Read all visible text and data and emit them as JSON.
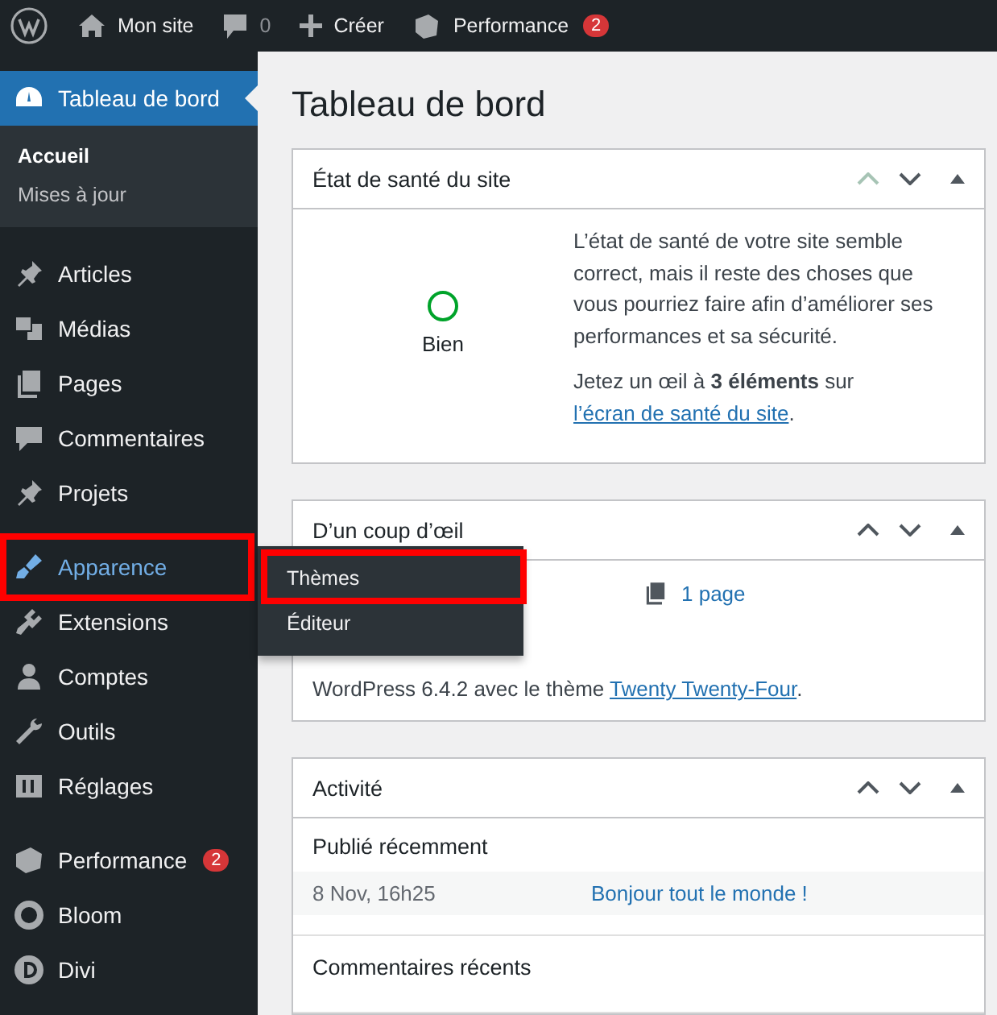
{
  "admin_bar": {
    "site": "Mon site",
    "comments": "0",
    "new": "Créer",
    "plugin": "Performance",
    "plugin_badge": "2"
  },
  "sidebar": {
    "items": [
      {
        "label": "Tableau de bord",
        "selected": true,
        "open": false,
        "highlighted": false,
        "children": [
          {
            "label": "Accueil",
            "selected": true
          },
          {
            "label": "Mises à jour",
            "selected": false
          }
        ]
      },
      {
        "label": "Articles",
        "selected": false,
        "open": false,
        "highlighted": false
      },
      {
        "label": "Médias",
        "selected": false,
        "open": false,
        "highlighted": false
      },
      {
        "label": "Pages",
        "selected": false,
        "open": false,
        "highlighted": false
      },
      {
        "label": "Commentaires",
        "selected": false,
        "open": false,
        "highlighted": false
      },
      {
        "label": "Projets",
        "selected": false,
        "open": false,
        "highlighted": false
      },
      {
        "label": "Apparence",
        "selected": false,
        "open": true,
        "highlighted": true,
        "flyout": [
          {
            "label": "Thèmes",
            "highlighted": true
          },
          {
            "label": "Éditeur",
            "highlighted": false
          }
        ]
      },
      {
        "label": "Extensions",
        "selected": false,
        "open": false,
        "highlighted": false
      },
      {
        "label": "Comptes",
        "selected": false,
        "open": false,
        "highlighted": false
      },
      {
        "label": "Outils",
        "selected": false,
        "open": false,
        "highlighted": false
      },
      {
        "label": "Réglages",
        "selected": false,
        "open": false,
        "highlighted": false
      },
      {
        "label": "Performance",
        "selected": false,
        "open": false,
        "highlighted": false,
        "badge": "2"
      },
      {
        "label": "Bloom",
        "selected": false,
        "open": false,
        "highlighted": false
      },
      {
        "label": "Divi",
        "selected": false,
        "open": false,
        "highlighted": false
      }
    ]
  },
  "page_title": "Tableau de bord",
  "health": {
    "title": "État de santé du site",
    "status": "Bien",
    "text": "L’état de santé de votre site semble correct, mais il reste des choses que vous pourriez faire afin d’améliorer ses performances et sa sécurité.",
    "note": "Jetez un œil à **3 éléments** sur ",
    "link": "l’écran de santé du site",
    "after": "."
  },
  "glance": {
    "title": "D’un coup d’œil",
    "pages": "1 page",
    "version": "WordPress 6.4.2 avec le thème ",
    "theme": "Twenty Twenty-Four",
    "after": "."
  },
  "activity": {
    "title": "Activité",
    "published": "Publié récemment",
    "rows": [
      {
        "date": "8 Nov, 16h25",
        "post": "Bonjour tout le monde !"
      }
    ],
    "comments": "Commentaires récents"
  }
}
